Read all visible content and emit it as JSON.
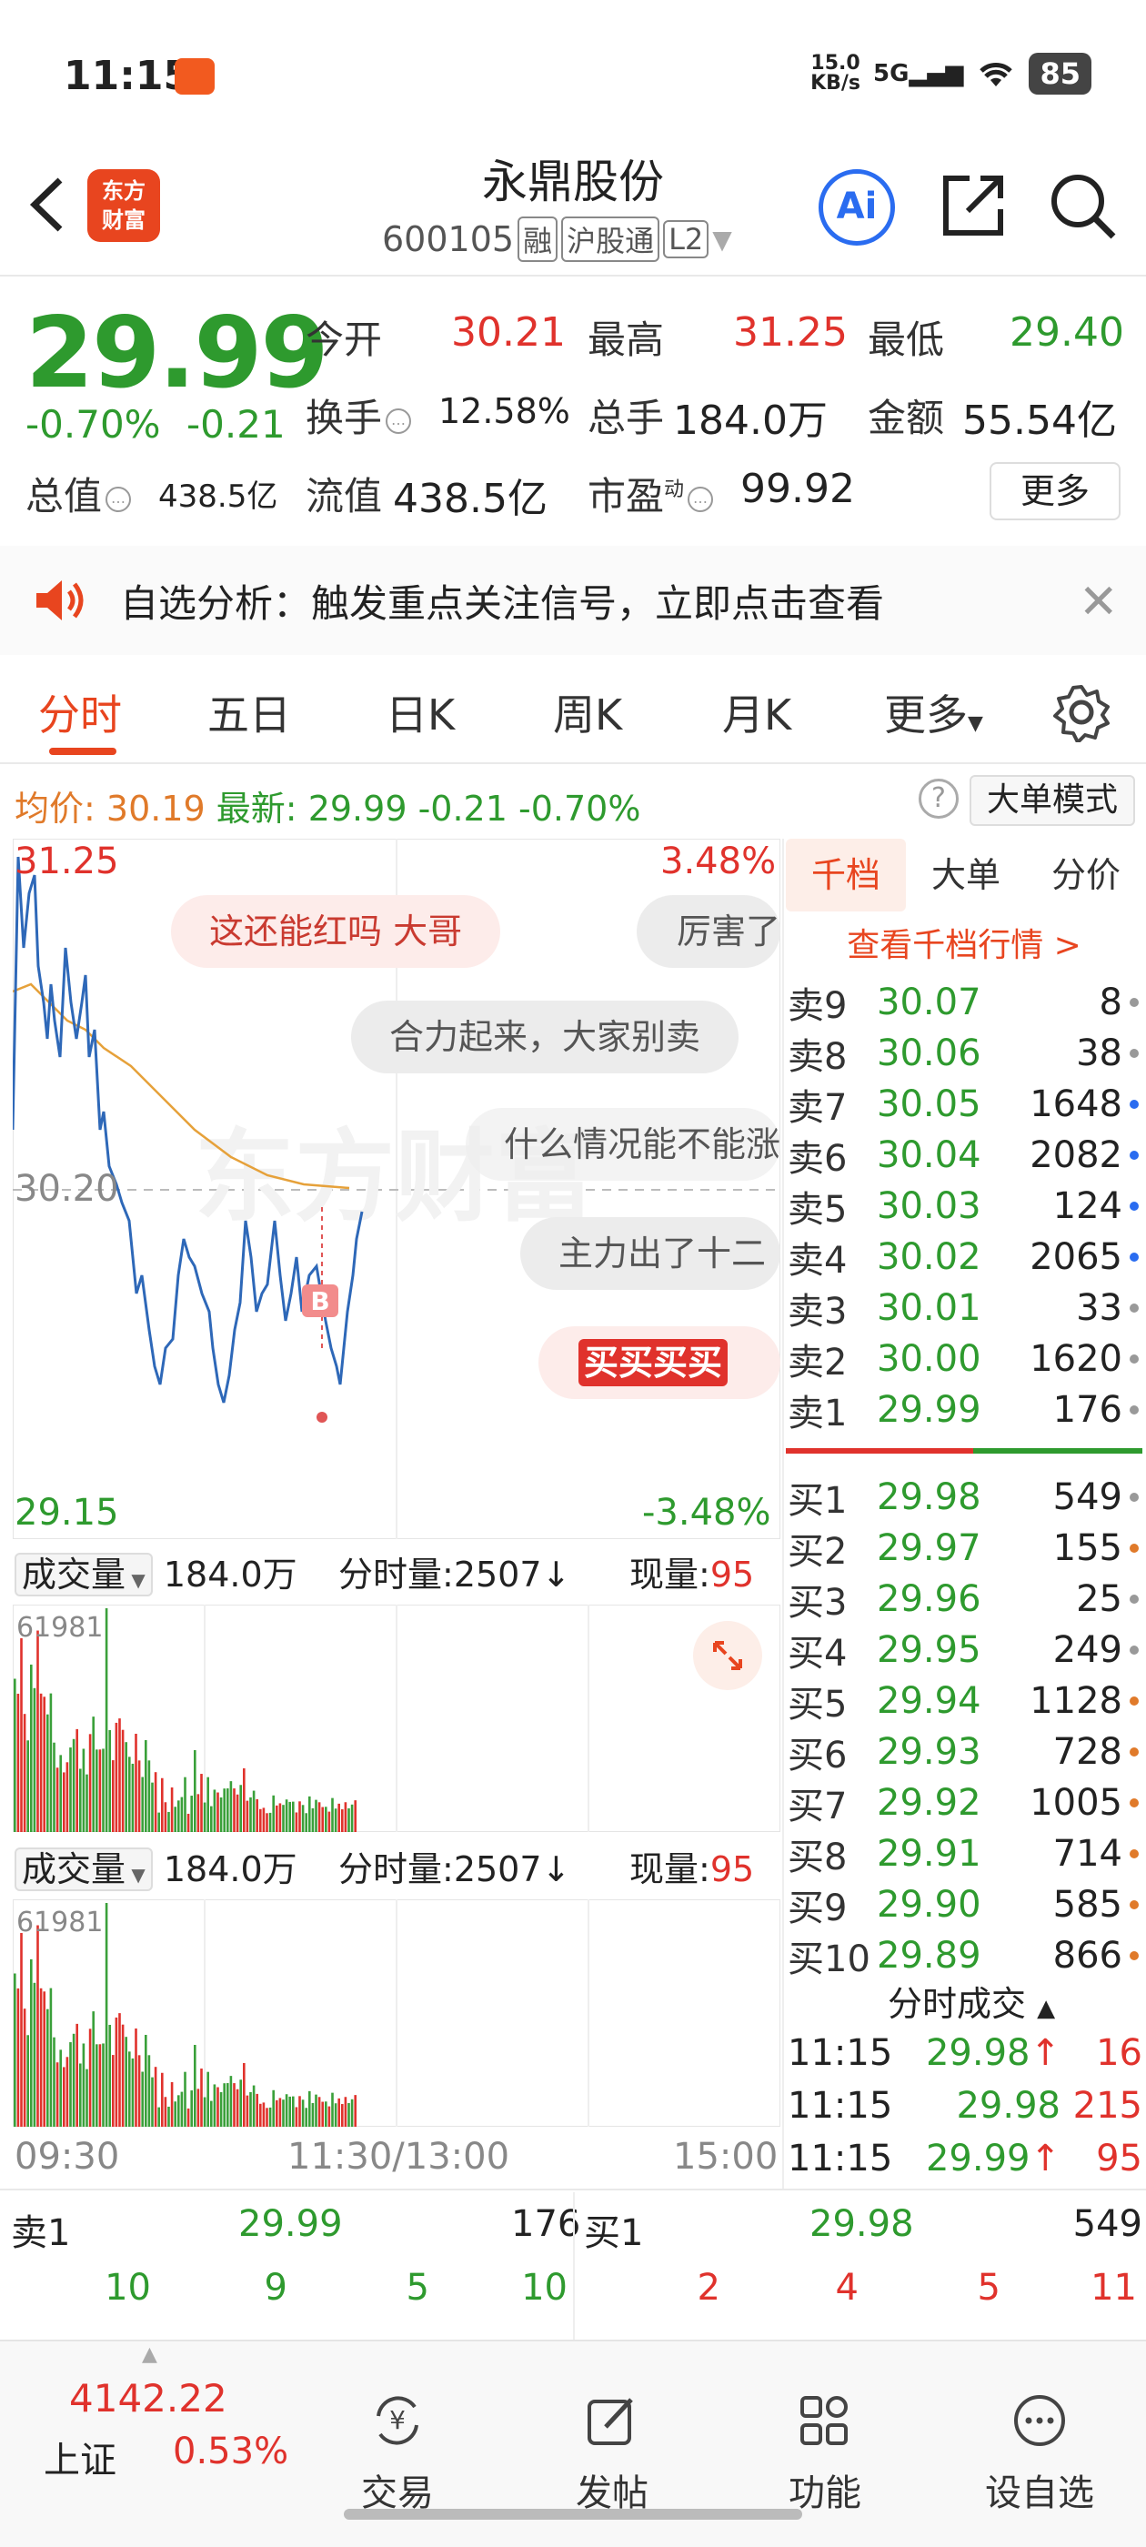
{
  "status": {
    "time": "11:15",
    "net_speed": "15.0",
    "net_unit": "KB/s",
    "signal": "5G",
    "battery": "85"
  },
  "header": {
    "stock_name": "永鼎股份",
    "stock_code": "600105",
    "tags": [
      "融",
      "沪股通",
      "L2"
    ],
    "logo_line1": "东方",
    "logo_line2": "财富",
    "ai_label": "Ai"
  },
  "quote": {
    "price": "29.99",
    "change_pct": "-0.70%",
    "change": "-0.21",
    "open_label": "今开",
    "open": "30.21",
    "high_label": "最高",
    "high": "31.25",
    "low_label": "最低",
    "low": "29.40",
    "turnover_label": "换手",
    "turnover": "12.58%",
    "volume_label": "总手",
    "volume": "184.0万",
    "amount_label": "金额",
    "amount": "55.54亿",
    "mktcap_label": "总值",
    "mktcap": "438.5亿",
    "float_label": "流值",
    "float": "438.5亿",
    "pe_label": "市盈",
    "pe_sup": "动",
    "pe": "99.92",
    "more": "更多"
  },
  "notice": {
    "text": "自选分析：触发重点关注信号，立即点击查看"
  },
  "tabs": [
    "分时",
    "五日",
    "日K",
    "周K",
    "月K",
    "更多"
  ],
  "info_row": {
    "avg_label": "均价:",
    "avg": "30.19",
    "latest_label": "最新:",
    "latest": "29.99",
    "chg": "-0.21",
    "chg_pct": "-0.70%",
    "big_order_mode": "大单模式"
  },
  "chart": {
    "top_price": "31.25",
    "top_pct": "3.48%",
    "mid_price": "30.20",
    "bottom_price": "29.15",
    "bottom_pct": "-3.48%",
    "watermark": "东方财富",
    "marker": "B",
    "x_labels": [
      "09:30",
      "11:30/13:00",
      "15:00"
    ]
  },
  "danmu": [
    "这还能红吗 大哥",
    "厉害了",
    "合力起来，大家别卖",
    "什么情况能不能涨",
    "主力出了十二",
    "买买买买"
  ],
  "volume_panels": [
    {
      "select": "成交量",
      "total": "184.0万",
      "tick_label": "分时量:",
      "tick": "2507",
      "now_label": "现量:",
      "now": "95",
      "max": "61981"
    },
    {
      "select": "成交量",
      "total": "184.0万",
      "tick_label": "分时量:",
      "tick": "2507",
      "now_label": "现量:",
      "now": "95",
      "max": "61981"
    }
  ],
  "orderbook": {
    "tabs": [
      "千档",
      "大单",
      "分价"
    ],
    "link": "查看千档行情 >",
    "asks": [
      {
        "label": "卖9",
        "price": "30.07",
        "vol": "8",
        "dot": "#999"
      },
      {
        "label": "卖8",
        "price": "30.06",
        "vol": "38",
        "dot": "#999"
      },
      {
        "label": "卖7",
        "price": "30.05",
        "vol": "1648",
        "dot": "#2a6cf0"
      },
      {
        "label": "卖6",
        "price": "30.04",
        "vol": "2082",
        "dot": "#2a6cf0"
      },
      {
        "label": "卖5",
        "price": "30.03",
        "vol": "124",
        "dot": "#2a6cf0"
      },
      {
        "label": "卖4",
        "price": "30.02",
        "vol": "2065",
        "dot": "#2a6cf0"
      },
      {
        "label": "卖3",
        "price": "30.01",
        "vol": "33",
        "dot": "#999"
      },
      {
        "label": "卖2",
        "price": "30.00",
        "vol": "1620",
        "dot": "#999"
      },
      {
        "label": "卖1",
        "price": "29.99",
        "vol": "176",
        "dot": "#999"
      }
    ],
    "bids": [
      {
        "label": "买1",
        "price": "29.98",
        "vol": "549",
        "dot": "#999"
      },
      {
        "label": "买2",
        "price": "29.97",
        "vol": "155",
        "dot": "#e07a2a"
      },
      {
        "label": "买3",
        "price": "29.96",
        "vol": "25",
        "dot": "#999"
      },
      {
        "label": "买4",
        "price": "29.95",
        "vol": "249",
        "dot": "#999"
      },
      {
        "label": "买5",
        "price": "29.94",
        "vol": "1128",
        "dot": "#e07a2a"
      },
      {
        "label": "买6",
        "price": "29.93",
        "vol": "728",
        "dot": "#e07a2a"
      },
      {
        "label": "买7",
        "price": "29.92",
        "vol": "1005",
        "dot": "#e07a2a"
      },
      {
        "label": "买8",
        "price": "29.91",
        "vol": "714",
        "dot": "#e07a2a"
      },
      {
        "label": "买9",
        "price": "29.90",
        "vol": "585",
        "dot": "#e07a2a"
      },
      {
        "label": "买10",
        "price": "29.89",
        "vol": "866",
        "dot": "#e07a2a"
      }
    ],
    "trades_title": "分时成交",
    "trades": [
      {
        "time": "11:15",
        "price": "29.98",
        "arrow": "↑",
        "vol": "16"
      },
      {
        "time": "11:15",
        "price": "29.98",
        "arrow": "",
        "vol": "215"
      },
      {
        "time": "11:15",
        "price": "29.99",
        "arrow": "↑",
        "vol": "95"
      }
    ]
  },
  "bottom_book": {
    "sell_label": "卖1",
    "sell_price": "29.99",
    "sell_vol": "176",
    "buy_label": "买1",
    "buy_price": "29.98",
    "buy_vol": "549",
    "sell_queue": [
      "10",
      "9",
      "5",
      "10"
    ],
    "buy_queue": [
      "2",
      "4",
      "5",
      "11"
    ]
  },
  "bottom_nav": {
    "index_value": "4142.22",
    "index_name": "上证",
    "index_pct": "0.53%",
    "items": [
      "交易",
      "发帖",
      "功能",
      "设自选"
    ]
  }
}
